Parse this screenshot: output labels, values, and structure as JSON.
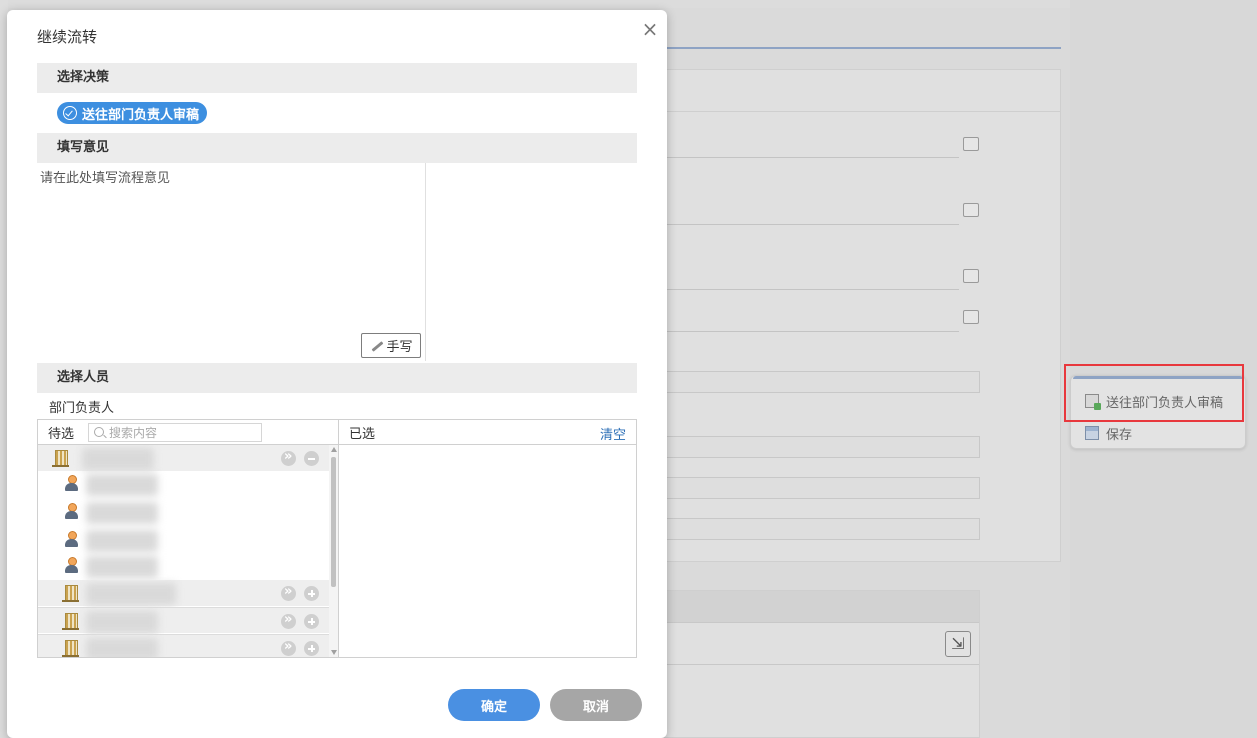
{
  "modal": {
    "title": "继续流转",
    "close_icon": "×",
    "decision_section": "选择决策",
    "decision_option": "送往部门负责人审稿",
    "opinion_section": "填写意见",
    "opinion_placeholder": "请在此处填写流程意见",
    "handwrite_label": "手写",
    "people_section": "选择人员",
    "dept_label": "部门负责人",
    "pending_label": "待选",
    "search_placeholder": "搜索内容",
    "selected_label": "已选",
    "clear_label": "清空",
    "ok_label": "确定",
    "cancel_label": "取消"
  },
  "action_menu": {
    "items": [
      {
        "label": "送往部门负责人审稿",
        "icon": "send-icon"
      },
      {
        "label": "保存",
        "icon": "save-icon"
      }
    ]
  },
  "colors": {
    "primary": "#4a90e2",
    "pill": "#3d8fe0",
    "cancel": "#a6a6a6",
    "highlight": "#e8383d",
    "link": "#2c6fb7"
  }
}
